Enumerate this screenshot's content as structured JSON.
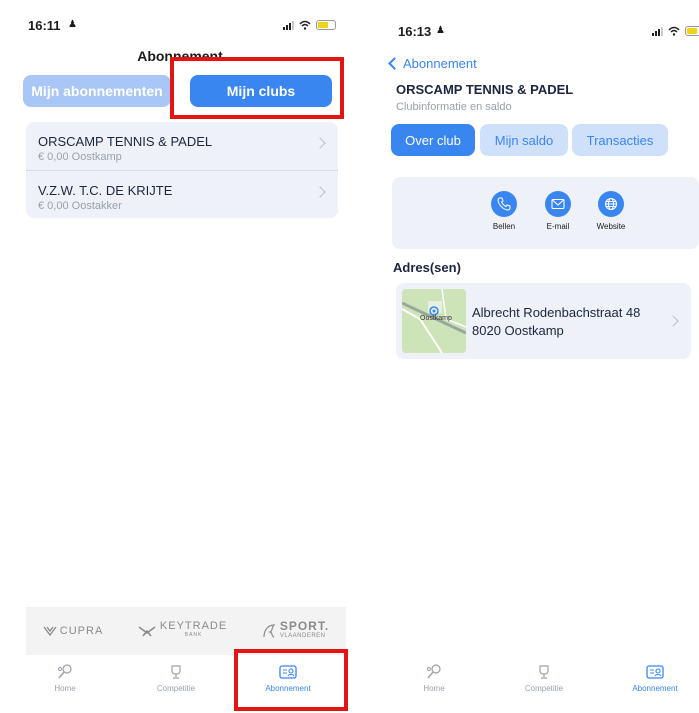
{
  "colors": {
    "accent": "#3a86f1",
    "accent_light": "#a9c7f6",
    "highlight": "#e31414",
    "card_bg": "#eef1f7"
  },
  "left_screen": {
    "status": {
      "time": "16:11"
    },
    "title": "Abonnement",
    "segments": {
      "subscriptions": "Mijn abonnementen",
      "clubs": "Mijn clubs"
    },
    "clubs": [
      {
        "name": "ORSCAMP TENNIS & PADEL",
        "sub": "€ 0,00  Oostkamp"
      },
      {
        "name": "V.Z.W. T.C. DE KRIJTE",
        "sub": "€ 0,00  Oostakker"
      }
    ],
    "sponsors": {
      "cupra": "CUPRA",
      "keytrade": "KEYTRADE",
      "keytrade_sub": "BANK",
      "sport": "SPORT.",
      "sport_sub": "VLAANDEREN"
    },
    "tabs": [
      {
        "label": "Home",
        "icon": "tennis-icon"
      },
      {
        "label": "Competitie",
        "icon": "trophy-icon"
      },
      {
        "label": "Abonnement",
        "icon": "id-card-icon"
      }
    ]
  },
  "right_screen": {
    "status": {
      "time": "16:13"
    },
    "back_label": "Abonnement",
    "club_name": "ORSCAMP TENNIS & PADEL",
    "club_subtitle": "Clubinformatie en saldo",
    "pills": {
      "over_club": "Over club",
      "saldo": "Mijn saldo",
      "transacties": "Transacties"
    },
    "actions": {
      "call": "Bellen",
      "email": "E-mail",
      "website": "Website"
    },
    "address_heading": "Adres(sen)",
    "map_label": "Oostkamp",
    "address": {
      "line1": "Albrecht Rodenbachstraat 48",
      "line2": "8020 Oostkamp"
    },
    "tabs": [
      {
        "label": "Home",
        "icon": "tennis-icon"
      },
      {
        "label": "Competitie",
        "icon": "trophy-icon"
      },
      {
        "label": "Abonnement",
        "icon": "id-card-icon"
      }
    ]
  }
}
